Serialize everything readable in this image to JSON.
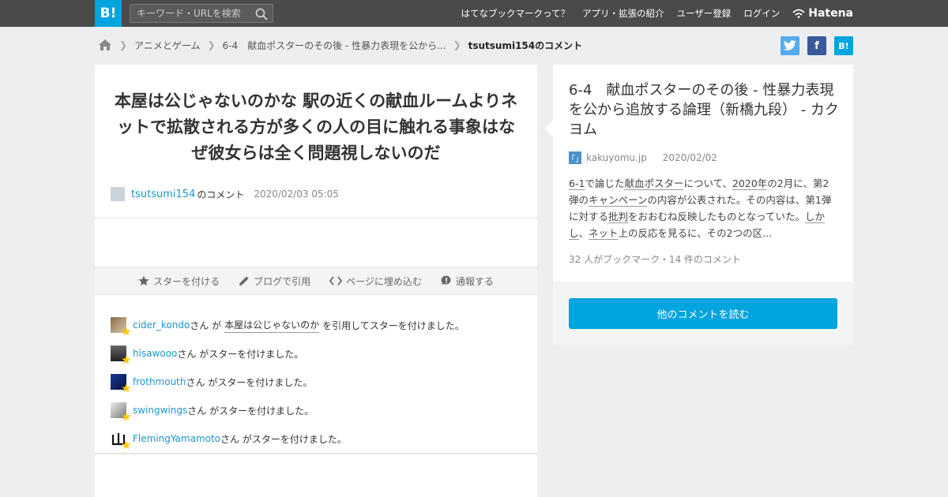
{
  "topbar": {
    "logo": "B!",
    "search_placeholder": "キーワード・URLを検索",
    "nav": [
      "はてなブックマークって？",
      "アプリ・拡張の紹介",
      "ユーザー登録",
      "ログイン"
    ],
    "brand": "Hatena"
  },
  "breadcrumb": {
    "items": [
      "アニメとゲーム",
      "6-4　献血ポスターのその後 - 性暴力表現を公から..."
    ],
    "current": "tsutsumi154のコメント"
  },
  "share": {
    "hatena_label": "B!"
  },
  "comment": {
    "text": "本屋は公じゃないのかな 駅の近くの献血ルームよりネットで拡散される方が多くの人の目に触れる事象はなぜ彼女らは全く問題視しないのだ",
    "user": "tsutsumi154",
    "user_suffix": "のコメント",
    "date": "2020/02/03 05:05"
  },
  "actions": [
    "スターを付ける",
    "ブログで引用",
    "ページに埋め込む",
    "通報する"
  ],
  "stars": [
    {
      "user": "cider_kondo",
      "pre": "さん が",
      "quote": "本屋は公じゃないのか",
      "post": "を引用してスターを付けました。"
    },
    {
      "user": "hisawooo",
      "pre": "さん がスターを付けました。",
      "quote": "",
      "post": ""
    },
    {
      "user": "frothmouth",
      "pre": "さん がスターを付けました。",
      "quote": "",
      "post": ""
    },
    {
      "user": "swingwings",
      "pre": "さん がスターを付けました。",
      "quote": "",
      "post": ""
    },
    {
      "user": "FlemingYamamoto",
      "pre": "さん がスターを付けました。",
      "quote": "",
      "post": ""
    }
  ],
  "entry": {
    "title": "6-4　献血ポスターのその後 - 性暴力表現を公から追放する論理（新橋九段） - カクヨム",
    "favicon": "「」",
    "domain": "kakuyomu.jp",
    "date": "2020/02/02",
    "body": {
      "s1": "6-1",
      "s2": "で論じた",
      "s3": "献血ポスター",
      "s4": "について、",
      "s5": "2020年",
      "s6": "の2月に、第2弾の",
      "s7": "キャンペーン",
      "s8": "の内容が公表された。その内容は、第1弾に対する",
      "s9": "批判",
      "s10": "をおおむね反映したものとなっていた。",
      "s11": "しかし",
      "s12": "、",
      "s13": "ネット",
      "s14": "上の反応を見るに、その2つの区..."
    },
    "counts": "32 人がブックマーク・14 件のコメント",
    "read_more": "他のコメントを読む"
  },
  "colors": {
    "accent": "#00a4de",
    "link": "#1f95c6",
    "topbar": "#4a4a4a",
    "star": "#ffcc00"
  }
}
